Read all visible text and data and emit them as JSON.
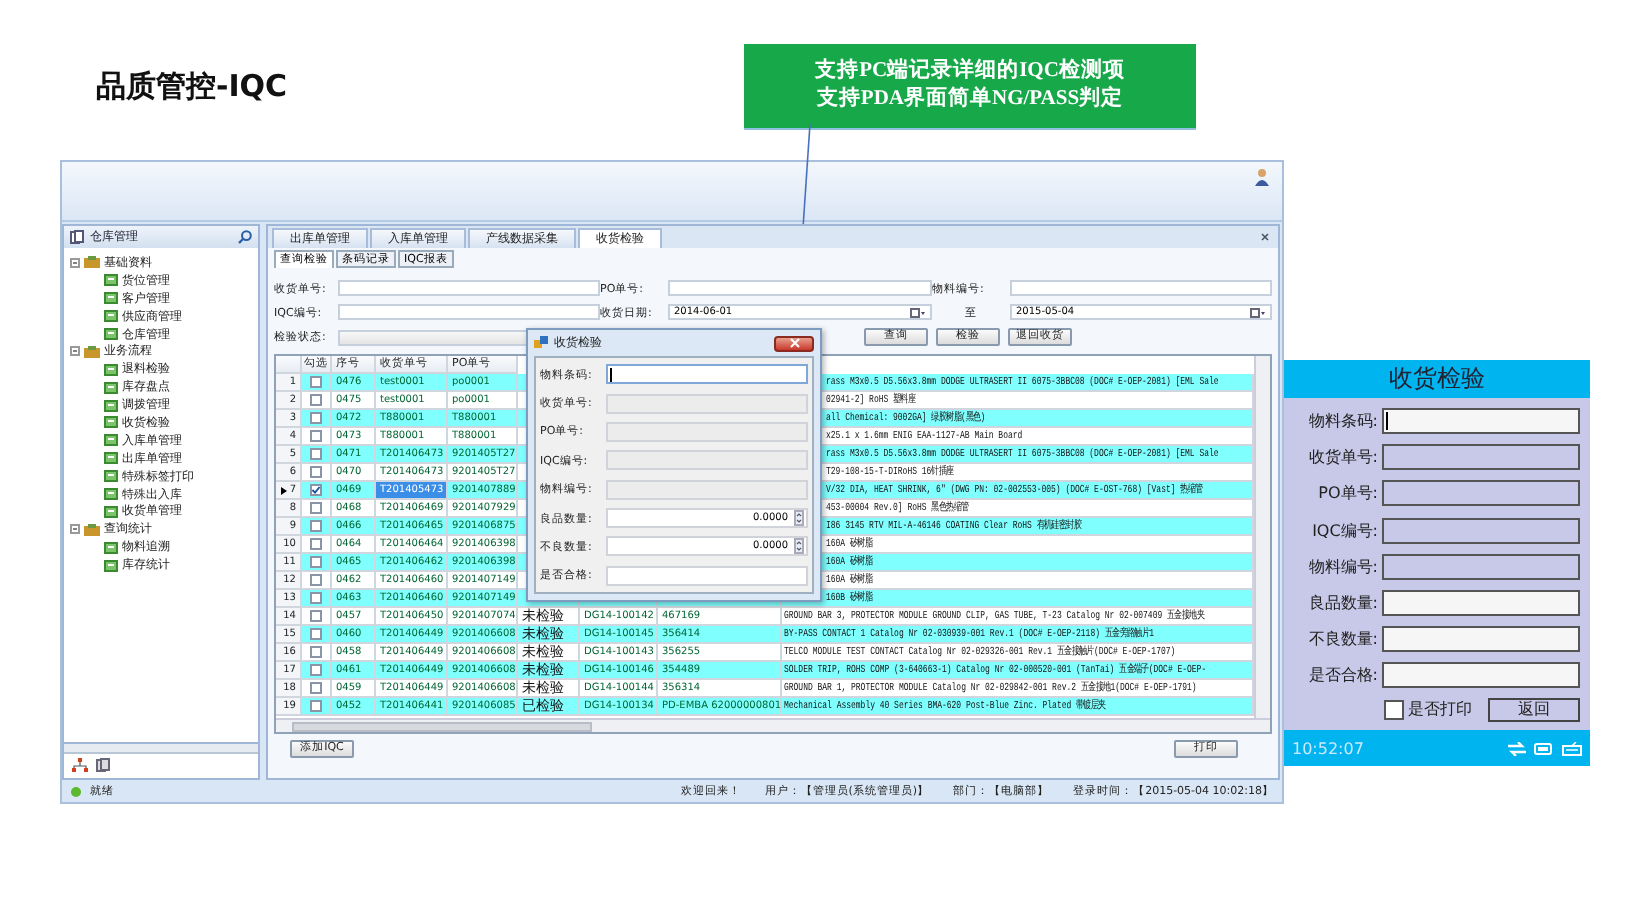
{
  "slide_title": "品质管控-IQC",
  "callout": [
    "支持PC端记录详细的IQC检测项",
    "支持PDA界面简单NG/PASS判定"
  ],
  "app": {
    "sidebar": {
      "title": "仓库管理",
      "tree": [
        {
          "label": "基础资料",
          "expanded": true,
          "children": [
            {
              "label": "货位管理"
            },
            {
              "label": "客户管理"
            },
            {
              "label": "供应商管理"
            },
            {
              "label": "仓库管理"
            }
          ]
        },
        {
          "label": "业务流程",
          "expanded": true,
          "children": [
            {
              "label": "退料检验"
            },
            {
              "label": "库存盘点"
            },
            {
              "label": "调拨管理"
            },
            {
              "label": "收货检验"
            },
            {
              "label": "入库单管理"
            },
            {
              "label": "出库单管理"
            },
            {
              "label": "特殊标签打印"
            },
            {
              "label": "特殊出入库"
            },
            {
              "label": "收货单管理"
            }
          ]
        },
        {
          "label": "查询统计",
          "expanded": true,
          "children": [
            {
              "label": "物料追溯"
            },
            {
              "label": "库存统计"
            }
          ]
        }
      ]
    },
    "tabs": [
      {
        "label": "出库单管理",
        "selected": false
      },
      {
        "label": "入库单管理",
        "selected": false
      },
      {
        "label": "产线数据采集",
        "selected": false
      },
      {
        "label": "收货检验",
        "selected": true
      }
    ],
    "subtabs": [
      {
        "label": "查询检验",
        "selected": true
      },
      {
        "label": "条码记录",
        "selected": false
      },
      {
        "label": "IQC报表",
        "selected": false
      }
    ],
    "filters": [
      {
        "label": "收货单号:",
        "kind": "text"
      },
      {
        "label": "PO单号:",
        "kind": "text"
      },
      {
        "label": "物料编号:",
        "kind": "text"
      },
      {
        "label": "IQC编号:",
        "kind": "text"
      },
      {
        "label": "收货日期:",
        "kind": "date",
        "value": "2014-06-01"
      },
      {
        "label": "至",
        "kind": "date",
        "value": "2015-05-04"
      },
      {
        "label": "检验状态:",
        "kind": "select"
      }
    ],
    "actions": [
      "查询",
      "检验",
      "退回收货"
    ],
    "table": {
      "check_column": "勾选",
      "columns": [
        "序号",
        "收货单号",
        "PO单号"
      ],
      "rows": [
        {
          "no": "1",
          "checked": false,
          "selected": false,
          "cells": [
            "0476",
            "test0001",
            "po0001"
          ],
          "description": "rass M3x0.5 D5.56x3.8mm DODGE ULTRASERT II 6075-3BBC08 (DOC# E-OEP-2081) [EML Sale"
        },
        {
          "no": "2",
          "checked": false,
          "selected": false,
          "cells": [
            "0475",
            "test0001",
            "po0001"
          ],
          "description": "02941-2] RoHS 塑料座"
        },
        {
          "no": "3",
          "checked": false,
          "selected": false,
          "cells": [
            "0472",
            "T880001",
            "T880001"
          ],
          "description": "all Chemical: 9002GA] 绿胶树脂(黑色)"
        },
        {
          "no": "4",
          "checked": false,
          "selected": false,
          "cells": [
            "0473",
            "T880001",
            "T880001"
          ],
          "description": "x25.1 x 1.6mm ENIG EAA-1127-AB Main Board"
        },
        {
          "no": "5",
          "checked": false,
          "selected": false,
          "cells": [
            "0471",
            "T201406473",
            "9201405T27"
          ],
          "description": "rass M3x0.5 D5.56x3.8mm DODGE ULTRASERT II 6075-3BBC08 (DOC# E-OEP-2081) [EML Sale"
        },
        {
          "no": "6",
          "checked": false,
          "selected": false,
          "cells": [
            "0470",
            "T201406473",
            "9201405T27"
          ],
          "description": "T29-108-15-T-DIRoHS 16针插座"
        },
        {
          "no": "7",
          "checked": true,
          "selected": true,
          "cells": [
            "0469",
            "T201405473",
            "9201407889"
          ],
          "description": "V/32 DIA, HEAT SHRINK, 6\" (DWG PN: 02-002553-005) (DOC# E-OST-768) [Vast] 热缩管"
        },
        {
          "no": "8",
          "checked": false,
          "selected": false,
          "cells": [
            "0468",
            "T201406469",
            "9201407929"
          ],
          "description": "453-00004 Rev.0] RoHS 黑色热缩管"
        },
        {
          "no": "9",
          "checked": false,
          "selected": false,
          "cells": [
            "0466",
            "T201406465",
            "9201406875"
          ],
          "description": "I86 3145 RTV MIL-A-46146 COATING  Clear RoHS  有机硅密封胶"
        },
        {
          "no": "10",
          "checked": false,
          "selected": false,
          "cells": [
            "0464",
            "T201406464",
            "9201406398"
          ],
          "description": "160A 矽树脂"
        },
        {
          "no": "11",
          "checked": false,
          "selected": false,
          "cells": [
            "0465",
            "T201406462",
            "9201406398"
          ],
          "description": "160A 矽树脂"
        },
        {
          "no": "12",
          "checked": false,
          "selected": false,
          "cells": [
            "0462",
            "T201406460",
            "9201407149"
          ],
          "description": "160A 矽树脂"
        },
        {
          "no": "13",
          "checked": false,
          "selected": false,
          "cells": [
            "0463",
            "T201406460",
            "9201407149"
          ],
          "description": "160B 矽树脂"
        },
        {
          "no": "14",
          "checked": false,
          "selected": false,
          "cells": [
            "0457",
            "T201406450",
            "9201407074",
            "未检验",
            "DG14-100142",
            "467169"
          ],
          "description": "GROUND BAR 3, PROTECTOR MODULE GROUND CLIP, GAS TUBE, T-23 Catalog Nr 02-007409 五金接地夹"
        },
        {
          "no": "15",
          "checked": false,
          "selected": false,
          "cells": [
            "0460",
            "T201406449",
            "9201406608",
            "未检验",
            "DG14-100145",
            "356414"
          ],
          "description": "BY-PASS CONTACT 1 Catalog Nr 02-030939-001 Rev.1 (DOC# E-OEP-2118) 五金旁路触片1"
        },
        {
          "no": "16",
          "checked": false,
          "selected": false,
          "cells": [
            "0458",
            "T201406449",
            "9201406608",
            "未检验",
            "DG14-100143",
            "356255"
          ],
          "description": "TELCO MODULE TEST CONTACT Catalog Nr 02-029326-001 Rev.1 五金接触片(DOC# E-OEP-1707)"
        },
        {
          "no": "17",
          "checked": false,
          "selected": false,
          "cells": [
            "0461",
            "T201406449",
            "9201406608",
            "未检验",
            "DG14-100146",
            "354489"
          ],
          "description": "SOLDER TRIP, ROHS COMP (3-640663-1) Catalog Nr 02-000520-001 (TanTai) 五金端子(DOC# E-OEP-"
        },
        {
          "no": "18",
          "checked": false,
          "selected": false,
          "cells": [
            "0459",
            "T201406449",
            "9201406608",
            "未检验",
            "DG14-100144",
            "356314"
          ],
          "description": "GROUND BAR 1, PROTECTOR MODULE Catalog Nr 02-029842-001 Rev.2 五金接地1(DOC# E-OEP-1791)"
        },
        {
          "no": "19",
          "checked": false,
          "selected": false,
          "cells": [
            "0452",
            "T201406441",
            "9201406085",
            "已检验",
            "DG14-100134",
            "PD-EMBA 62000000801"
          ],
          "description": "Mechanical Assembly 40 Series BMA-620 Post-Blue Zinc. Plated 带镀层夹"
        }
      ]
    },
    "bottom_buttons": [
      "添加IQC",
      "打印"
    ],
    "status_bar": {
      "ready": "就绪",
      "items": [
        "欢迎回来！",
        "用户：【管理员(系统管理员)】",
        "部门：【电脑部】",
        "登录时间：【2015-05-04 10:02:18】"
      ]
    }
  },
  "dialog": {
    "title": "收货检验",
    "fields": [
      {
        "label": "物料条码:",
        "kind": "input"
      },
      {
        "label": "收货单号:",
        "kind": "disabled"
      },
      {
        "label": "PO单号:",
        "kind": "disabled"
      },
      {
        "label": "IQC编号:",
        "kind": "disabled"
      },
      {
        "label": "物料编号:",
        "kind": "disabled"
      },
      {
        "label": "良品数量:",
        "kind": "number",
        "value": "0.0000"
      },
      {
        "label": "不良数量:",
        "kind": "number",
        "value": "0.0000"
      },
      {
        "label": "是否合格:",
        "kind": "input"
      }
    ]
  },
  "pda": {
    "title": "收货检验",
    "fields": [
      {
        "label": "物料条码:",
        "kind": "input"
      },
      {
        "label": "收货单号:",
        "kind": "disabled"
      },
      {
        "label": "PO单号:",
        "kind": "disabled"
      },
      {
        "label": "IQC编号:",
        "kind": "disabled"
      },
      {
        "label": "物料编号:",
        "kind": "disabled"
      },
      {
        "label": "良品数量:",
        "kind": "input"
      },
      {
        "label": "不良数量:",
        "kind": "input"
      },
      {
        "label": "是否合格:",
        "kind": "input"
      }
    ],
    "print": {
      "label": "是否打印",
      "checked": false
    },
    "back": "返回",
    "time": "10:52:07"
  }
}
